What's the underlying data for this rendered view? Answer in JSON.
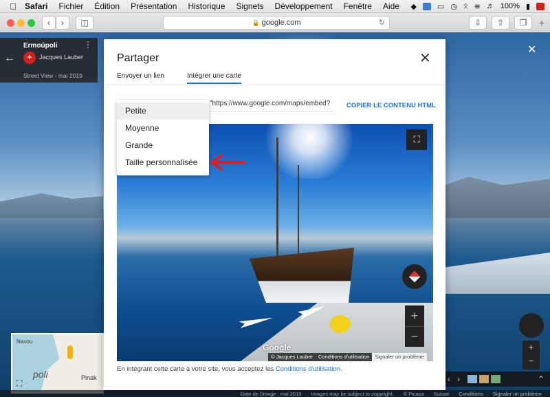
{
  "menubar": {
    "items": [
      "Safari",
      "Fichier",
      "Édition",
      "Présentation",
      "Historique",
      "Signets",
      "Développement",
      "Fenêtre",
      "Aide"
    ],
    "battery": "100%"
  },
  "browser": {
    "url": "google.com"
  },
  "streetview": {
    "place": "Ermoúpoli",
    "author": "Jacques Lauber",
    "date": "Street View - mai 2019",
    "minimap_labels": [
      "Naxou",
      "poli",
      "Pinak"
    ]
  },
  "dialog": {
    "title": "Partager",
    "tabs": [
      {
        "label": "Envoyer un lien",
        "active": false
      },
      {
        "label": "Intégrer une carte",
        "active": true
      }
    ],
    "embed_code": "\"https://www.google.com/maps/embed?",
    "copy_label": "COPIER LE CONTENU HTML",
    "size_options": [
      "Petite",
      "Moyenne",
      "Grande",
      "Taille personnalisée"
    ],
    "selected_size": "Petite",
    "preview": {
      "logo": "Google",
      "attribution": [
        "© Jacques Lauber",
        "Conditions d'utilisation",
        "Signaler un problème"
      ]
    },
    "agreement_text": "En intégrant cette carte à votre site, vous acceptez les ",
    "agreement_link": "Conditions d'utilisation",
    "agreement_end": "."
  },
  "footer": {
    "items": [
      "Date de l'image : mai 2019",
      "Images may be subject to copyright.",
      "© Picasa",
      "Suisse",
      "Conditions",
      "Signaler un problème"
    ]
  },
  "colors": {
    "accent": "#1a73e8",
    "annotation_red": "#e11d1d"
  }
}
